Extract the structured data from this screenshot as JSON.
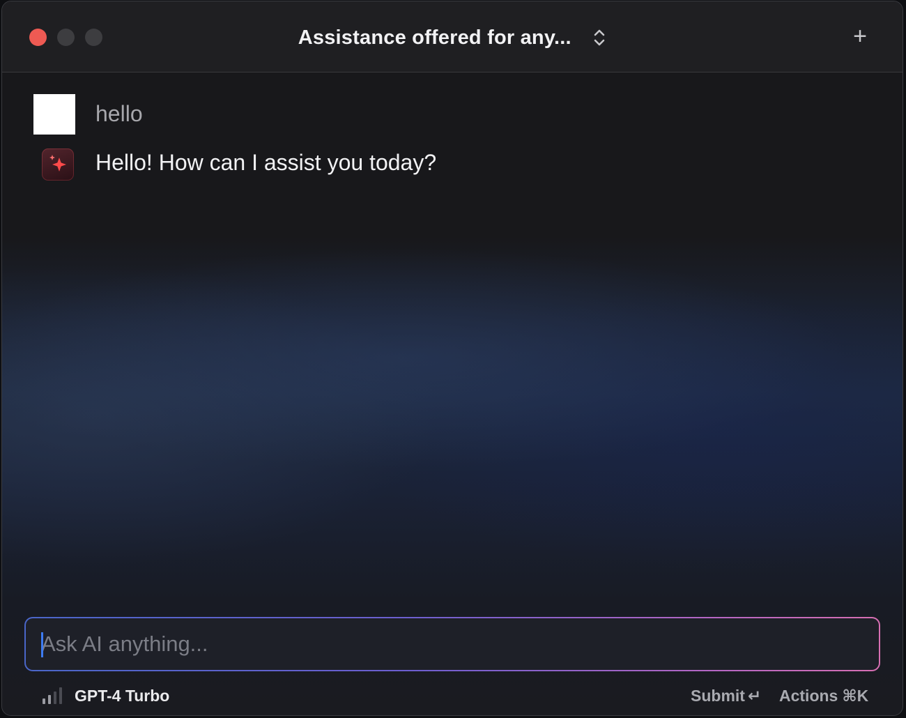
{
  "window": {
    "title": "Assistance offered for any...",
    "new_chat_symbol": "+"
  },
  "messages": [
    {
      "role": "user",
      "text": "hello"
    },
    {
      "role": "assistant",
      "text": "Hello! How can I assist you today?"
    }
  ],
  "composer": {
    "placeholder": "Ask AI anything...",
    "value": ""
  },
  "footer": {
    "model": "GPT-4 Turbo",
    "submit_label": "Submit",
    "submit_shortcut": "↵",
    "actions_label": "Actions",
    "actions_shortcut": "⌘K"
  },
  "icons": {
    "close": "close-traffic-light",
    "minimize": "minimize-traffic-light",
    "maximize": "maximize-traffic-light",
    "title_switcher": "chevron-up-down-icon",
    "new_chat": "plus-icon",
    "assistant_avatar": "sparkle-icon",
    "model_strength": "signal-bars-icon"
  },
  "colors": {
    "close": "#ee5a53",
    "accent_sparkle": "#ff4a4a",
    "input_border_start": "#4a66c9",
    "input_border_end": "#d76fb2",
    "caret": "#3d7bf2"
  }
}
